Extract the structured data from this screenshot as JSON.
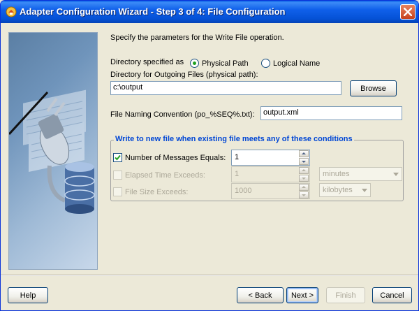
{
  "window": {
    "title": "Adapter Configuration Wizard - Step 3 of 4: File Configuration",
    "close_icon": "close-icon",
    "title_icon": "wizard-app-icon"
  },
  "main": {
    "intro": "Specify the parameters for the Write File operation.",
    "directory_specified_label": "Directory specified as",
    "radio_physical": {
      "label": "Physical Path",
      "selected": true
    },
    "radio_logical": {
      "label": "Logical Name",
      "selected": false
    },
    "outgoing_dir_label": "Directory for Outgoing Files (physical path):",
    "outgoing_dir_value": "c:\\output",
    "browse_label": "Browse",
    "naming_label": "File Naming Convention (po_%SEQ%.txt):",
    "naming_value": "output.xml"
  },
  "conditions": {
    "title": "Write to new file when existing file meets any of these conditions",
    "messages": {
      "label": "Number of Messages Equals:",
      "checked": true,
      "value": "1"
    },
    "elapsed": {
      "label": "Elapsed Time Exceeds:",
      "checked": false,
      "value": "1",
      "unit": "minutes"
    },
    "filesize": {
      "label": "File Size Exceeds:",
      "checked": false,
      "value": "1000",
      "unit": "kilobytes"
    }
  },
  "footer": {
    "help": "Help",
    "back": "< Back",
    "next": "Next >",
    "finish": "Finish",
    "cancel": "Cancel"
  },
  "colors": {
    "title_bar": "#0552d6",
    "group_title": "#0046d5",
    "window_bg": "#ece9d8"
  }
}
